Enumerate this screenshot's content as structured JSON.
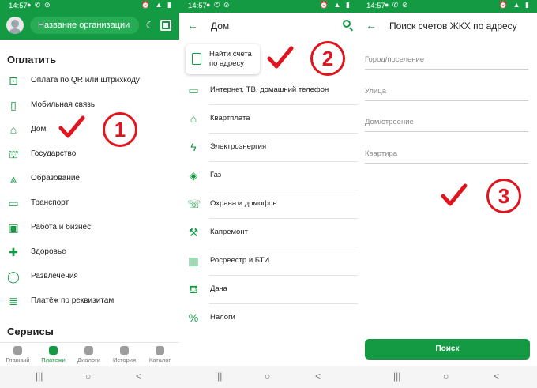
{
  "status_bar": {
    "time": "14:57",
    "status_icons": "● ✆ ⊘",
    "right_icons": "⏰ ▲ ▮"
  },
  "screen1": {
    "search_placeholder": "Название организации",
    "pay_section_title": "Оплатить",
    "menu": [
      {
        "label": "Оплата по QR или штрихкоду",
        "icon": "qr-scan-icon",
        "glyph": "⊡"
      },
      {
        "label": "Мобильная связь",
        "icon": "phone-icon",
        "glyph": "▯"
      },
      {
        "label": "Дом",
        "icon": "home-icon",
        "glyph": "⌂"
      },
      {
        "label": "Государство",
        "icon": "government-icon",
        "glyph": "⛫"
      },
      {
        "label": "Образование",
        "icon": "graduation-cap-icon",
        "glyph": "⩓"
      },
      {
        "label": "Транспорт",
        "icon": "bus-icon",
        "glyph": "▭"
      },
      {
        "label": "Работа и бизнес",
        "icon": "briefcase-icon",
        "glyph": "▣"
      },
      {
        "label": "Здоровье",
        "icon": "health-cross-icon",
        "glyph": "✚"
      },
      {
        "label": "Развлечения",
        "icon": "balloon-icon",
        "glyph": "◯"
      },
      {
        "label": "Платёж по реквизитам",
        "icon": "document-icon",
        "glyph": "≣"
      }
    ],
    "services_section_title": "Сервисы",
    "bottom_nav": [
      {
        "label": "Главный",
        "icon": "home-icon",
        "active": false
      },
      {
        "label": "Платежи",
        "icon": "payments-arrow-icon",
        "active": true
      },
      {
        "label": "Диалоги",
        "icon": "chat-icon",
        "active": false
      },
      {
        "label": "История",
        "icon": "clock-icon",
        "active": false
      },
      {
        "label": "Каталог",
        "icon": "cart-icon",
        "active": false
      }
    ]
  },
  "screen2": {
    "title": "Дом",
    "find_card_label": "Найти счета по адресу",
    "items": [
      {
        "label": "Интернет, ТВ, домашний телефон",
        "icon": "tv-icon",
        "glyph": "▭"
      },
      {
        "label": "Квартплата",
        "icon": "house-icon",
        "glyph": "⌂"
      },
      {
        "label": "Электроэнергия",
        "icon": "lightning-icon",
        "glyph": "ϟ"
      },
      {
        "label": "Газ",
        "icon": "flame-icon",
        "glyph": "◈"
      },
      {
        "label": "Охрана и домофон",
        "icon": "intercom-icon",
        "glyph": "☏"
      },
      {
        "label": "Капремонт",
        "icon": "hammer-icon",
        "glyph": "⚒"
      },
      {
        "label": "Росреестр и БТИ",
        "icon": "map-icon",
        "glyph": "▥"
      },
      {
        "label": "Дача",
        "icon": "watering-can-icon",
        "glyph": "⛾"
      },
      {
        "label": "Налоги",
        "icon": "percent-icon",
        "glyph": "%"
      }
    ]
  },
  "screen3": {
    "title": "Поиск счетов ЖКХ по адресу",
    "fields": [
      {
        "placeholder": "Город/поселение",
        "value": ""
      },
      {
        "placeholder": "Улица",
        "value": ""
      },
      {
        "placeholder": "Дом/строение",
        "value": ""
      },
      {
        "placeholder": "Квартира",
        "value": ""
      }
    ],
    "search_button": "Поиск"
  },
  "annotations": {
    "color": "#e0141e",
    "steps": [
      "1",
      "2",
      "3"
    ]
  },
  "colors": {
    "brand_green": "#159a44",
    "annotation_red": "#e0141e"
  },
  "system_nav": {
    "recent": "|||",
    "home": "○",
    "back": "<"
  }
}
